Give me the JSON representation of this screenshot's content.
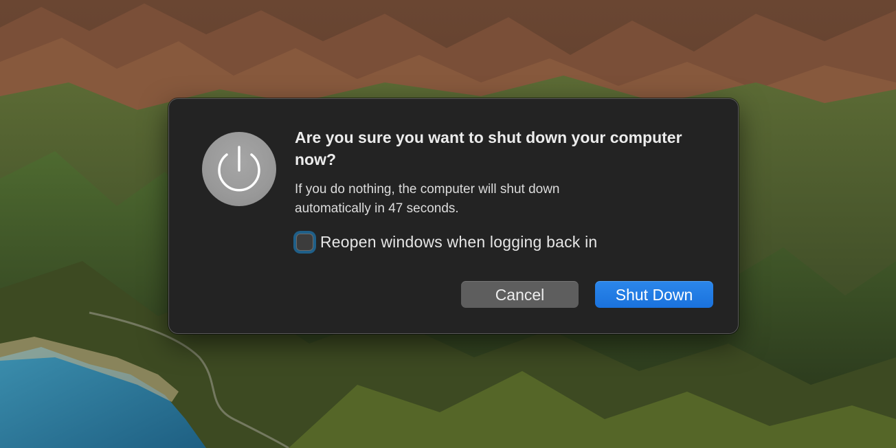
{
  "dialog": {
    "icon": "power-icon",
    "title": "Are you sure you want to shut down your computer now?",
    "message_line1": "If you do nothing, the computer will shut down",
    "message_line2": "automatically in 47 seconds.",
    "checkbox": {
      "label": "Reopen windows when logging back in",
      "checked": false
    },
    "buttons": {
      "cancel": "Cancel",
      "shut_down": "Shut Down"
    }
  },
  "colors": {
    "dialog_background": "#232323",
    "primary_button": "#1a72dd",
    "secondary_button": "#5e5e5e",
    "focus_ring": "#1f5f88"
  }
}
